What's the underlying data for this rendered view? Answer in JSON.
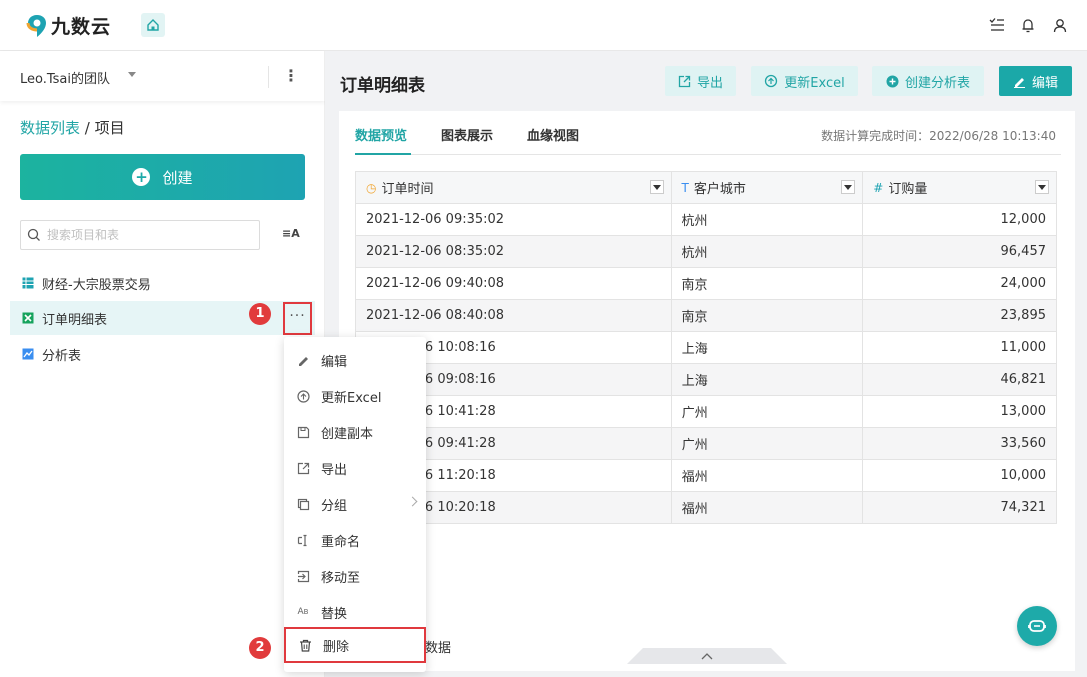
{
  "app": {
    "name": "九数云"
  },
  "sidebar": {
    "team_name": "Leo.Tsai的团队",
    "breadcrumb": {
      "root": "数据列表",
      "separator": " / ",
      "current": "项目"
    },
    "create_label": "创建",
    "search_placeholder": "搜索项目和表",
    "sort_label": "≡A",
    "items": [
      {
        "label": "财经-大宗股票交易",
        "icon": "table-icon"
      },
      {
        "label": "订单明细表",
        "icon": "excel-icon"
      },
      {
        "label": "分析表",
        "icon": "chart-icon"
      }
    ],
    "item_more": "···",
    "badges": [
      "1",
      "2"
    ]
  },
  "context_menu": {
    "items": [
      {
        "label": "编辑",
        "icon": "pen-icon"
      },
      {
        "label": "更新Excel",
        "icon": "refresh-icon"
      },
      {
        "label": "创建副本",
        "icon": "save-icon"
      },
      {
        "label": "导出",
        "icon": "export-icon"
      },
      {
        "label": "分组",
        "icon": "group-icon",
        "submenu": true
      },
      {
        "label": "重命名",
        "icon": "rename-icon"
      },
      {
        "label": "移动至",
        "icon": "move-icon"
      },
      {
        "label": "替换",
        "icon": "replace-icon"
      },
      {
        "label": "删除",
        "icon": "trash-icon"
      }
    ]
  },
  "main": {
    "title": "订单明细表",
    "toolbar": {
      "export": "导出",
      "update_excel": "更新Excel",
      "create_analysis": "创建分析表",
      "edit": "编辑"
    },
    "tabs": [
      {
        "label": "数据预览"
      },
      {
        "label": "图表展示"
      },
      {
        "label": "血缘视图"
      }
    ],
    "calc_time": "数据计算完成时间：2022/06/28 10:13:40",
    "table": {
      "columns": [
        {
          "label": "订单时间",
          "icon": "◷"
        },
        {
          "label": "客户城市",
          "icon": "T"
        },
        {
          "label": "订购量",
          "icon": "#"
        }
      ],
      "rows": [
        [
          "2021-12-06 09:35:02",
          "杭州",
          "12,000"
        ],
        [
          "2021-12-06 08:35:02",
          "杭州",
          "96,457"
        ],
        [
          "2021-12-06 09:40:08",
          "南京",
          "24,000"
        ],
        [
          "2021-12-06 08:40:08",
          "南京",
          "23,895"
        ],
        [
          "06 10:08:16",
          "上海",
          "11,000"
        ],
        [
          "06 09:08:16",
          "上海",
          "46,821"
        ],
        [
          "06 10:41:28",
          "广州",
          "13,000"
        ],
        [
          "06 09:41:28",
          "广州",
          "33,560"
        ],
        [
          "06 11:20:18",
          "福州",
          "10,000"
        ],
        [
          "06 10:20:18",
          "福州",
          "74,321"
        ]
      ]
    },
    "bottom_label": "数据"
  },
  "colors": {
    "accent": "#21a5a5",
    "highlight": "#e0393e"
  }
}
